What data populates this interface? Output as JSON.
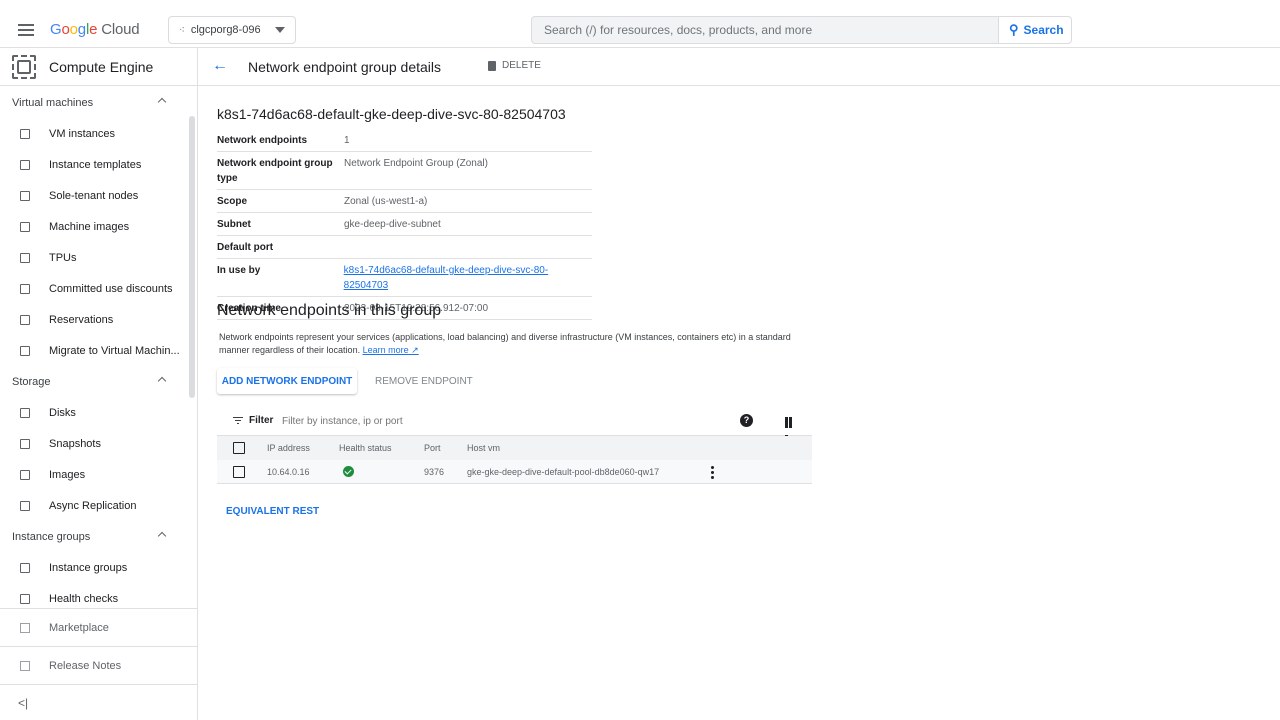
{
  "header": {
    "logo_google": "Google",
    "logo_cloud": "Cloud",
    "project": "clgcporg8-096",
    "search_placeholder": "Search (/) for resources, docs, products, and more",
    "search_button": "Search"
  },
  "sidenav": {
    "product": "Compute Engine",
    "sections": [
      {
        "label": "Virtual machines",
        "items": [
          "VM instances",
          "Instance templates",
          "Sole-tenant nodes",
          "Machine images",
          "TPUs",
          "Committed use discounts",
          "Reservations",
          "Migrate to Virtual Machin..."
        ]
      },
      {
        "label": "Storage",
        "items": [
          "Disks",
          "Snapshots",
          "Images",
          "Async Replication"
        ]
      },
      {
        "label": "Instance groups",
        "items": [
          "Instance groups",
          "Health checks"
        ]
      }
    ],
    "bottom": [
      "Marketplace",
      "Release Notes"
    ],
    "collapse": "<|"
  },
  "toolbar": {
    "back": "←",
    "title": "Network endpoint group details",
    "delete": "DELETE"
  },
  "neg": {
    "name": "k8s1-74d6ac68-default-gke-deep-dive-svc-80-82504703",
    "properties": [
      {
        "key": "Network endpoints",
        "value": "1"
      },
      {
        "key": "Network endpoint group type",
        "value": "Network Endpoint Group (Zonal)"
      },
      {
        "key": "Scope",
        "value": "Zonal (us-west1-a)"
      },
      {
        "key": "Subnet",
        "value": "gke-deep-dive-subnet"
      },
      {
        "key": "Default port",
        "value": ""
      },
      {
        "key": "In use by",
        "value": "k8s1-74d6ac68-default-gke-deep-dive-svc-80-82504703"
      },
      {
        "key": "Creation time",
        "value": "2023-08-15T19:28:56.912-07:00"
      }
    ]
  },
  "endpoints": {
    "title": "Network endpoints in this group",
    "description": "Network endpoints represent your services (applications, load balancing) and diverse infrastructure (VM instances, containers etc) in a standard manner regardless of their location.",
    "learn_more": "Learn more",
    "add_button": "ADD NETWORK ENDPOINT",
    "remove_button": "REMOVE ENDPOINT",
    "filter_label": "Filter",
    "filter_placeholder": "Filter by instance, ip or port",
    "columns": [
      "IP address",
      "Health status",
      "Port",
      "Host vm"
    ],
    "rows": [
      {
        "ip": "10.64.0.16",
        "health": "healthy",
        "port": "9376",
        "vm": "gke-gke-deep-dive-default-pool-db8de060-qw17"
      }
    ],
    "equivalent_rest": "EQUIVALENT REST"
  }
}
